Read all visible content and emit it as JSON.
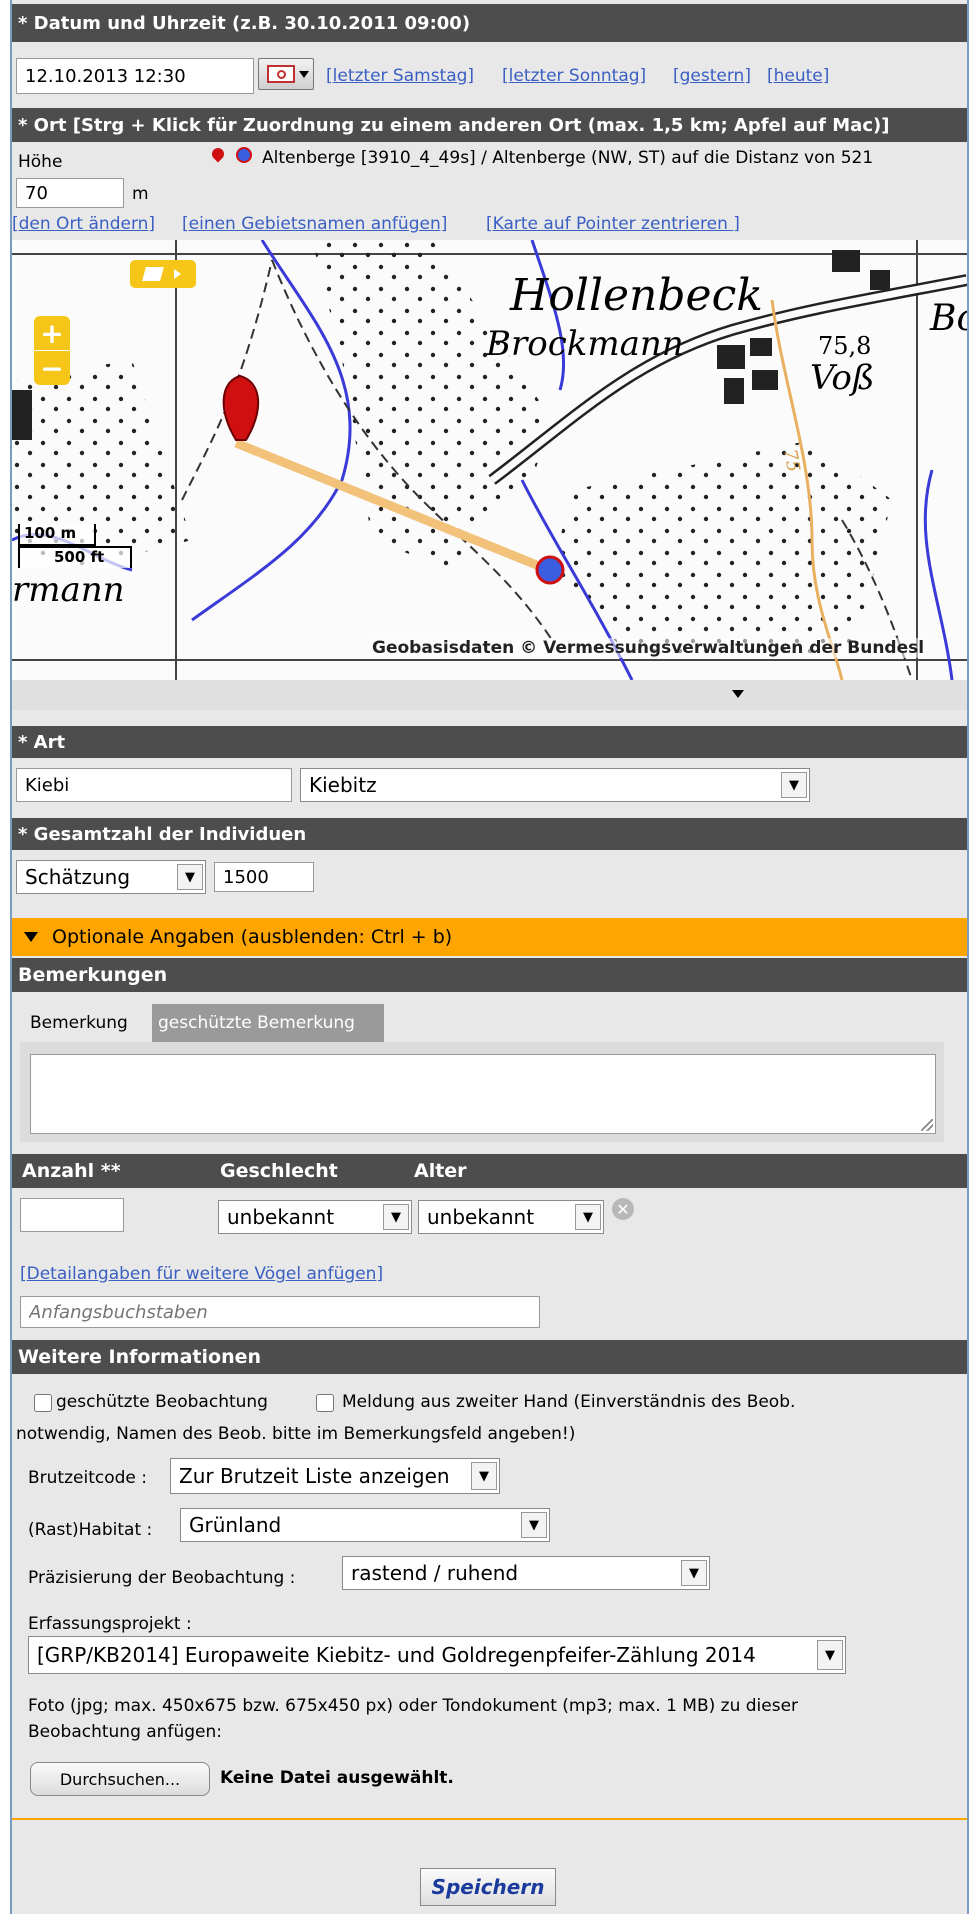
{
  "sections": {
    "datetime_header": "* Datum und Uhrzeit (z.B. 30.10.2011 09:00)",
    "location_header": "* Ort [Strg + Klick für Zuordnung zu einem anderen Ort (max. 1,5 km; Apfel auf Mac)]",
    "species_header": "* Art",
    "count_header": "* Gesamtzahl der Individuen",
    "optional_header": "Optionale Angaben (ausblenden: Ctrl + b)",
    "remarks_header": "Bemerkungen",
    "more_info_header": "Weitere Informationen"
  },
  "datetime": {
    "value": "12.10.2013 12:30",
    "links": [
      "[letzter Samstag]",
      "[letzter Sonntag]",
      "[gestern]",
      "[heute]"
    ]
  },
  "location": {
    "height_label": "Höhe",
    "height_value": "70",
    "height_unit": "m",
    "place_text": "Altenberge [3910_4_49s] / Altenberge (NW, ST) auf die Distanz von 521",
    "links": [
      "[den Ort ändern]",
      "[einen Gebietsnamen anfügen]",
      "[Karte auf Pointer zentrieren ]"
    ]
  },
  "map": {
    "labels": {
      "hollenbeck": "Hollenbeck",
      "brockmann": "Brockmann",
      "voss": "Voß",
      "elevation": "75,8",
      "bo": "Bo",
      "rmann": "rmann",
      "contour": "75"
    },
    "scale_m": "100 m",
    "scale_ft": "500 ft",
    "attribution": "Geobasisdaten © Vermessungsverwaltungen der Bundesl",
    "zoom_in": "+",
    "zoom_out": "−"
  },
  "species": {
    "abbrev_value": "Kiebi",
    "selected": "Kiebitz"
  },
  "count": {
    "mode": "Schätzung",
    "value": "1500"
  },
  "remarks": {
    "tab_remark": "Bemerkung",
    "tab_protected": "geschützte Bemerkung",
    "text": ""
  },
  "details": {
    "col_count": "Anzahl **",
    "col_sex": "Geschlecht",
    "col_age": "Alter",
    "count_value": "",
    "sex": "unbekannt",
    "age": "unbekannt",
    "add_link": "[Detailangaben für weitere Vögel anfügen]",
    "initials_placeholder": "Anfangsbuchstaben"
  },
  "more_info": {
    "protected_obs": "geschützte Beobachtung",
    "second_hand_1": "Meldung aus zweiter Hand (Einverständnis des Beob.",
    "second_hand_2": "notwendig, Namen des Beob. bitte im Bemerkungsfeld angeben!)",
    "breeding_label": "Brutzeitcode :",
    "breeding_value": "Zur Brutzeit Liste anzeigen",
    "habitat_label": "(Rast)Habitat :",
    "habitat_value": "Grünland",
    "precision_label": "Präzisierung der Beobachtung :",
    "precision_value": "rastend / ruhend",
    "project_label": "Erfassungsprojekt :",
    "project_value": "[GRP/KB2014] Europaweite Kiebitz- und Goldregenpfeifer-Zählung 2014",
    "file_text_1": "Foto (jpg; max. 450x675 bzw. 675x450 px) oder Tondokument (mp3; max. 1 MB) zu dieser",
    "file_text_2": "Beobachtung anfügen:",
    "browse_button": "Durchsuchen...",
    "no_file": "Keine Datei ausgewählt."
  },
  "save_button": "Speichern",
  "colors": {
    "header_bg": "#4d4d4d",
    "optional_bg": "#ffa500",
    "link": "#3a5fc2",
    "frame_border": "#7a9bc3"
  }
}
